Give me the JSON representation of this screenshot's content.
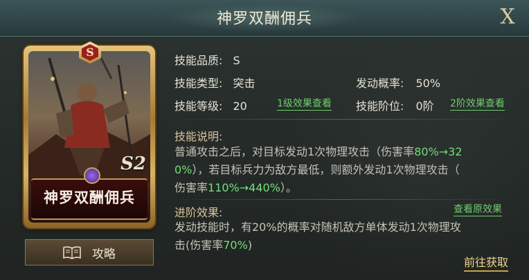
{
  "header": {
    "title": "神罗双酬佣兵",
    "close_label": "X"
  },
  "card": {
    "quality": "S",
    "name": "神罗双酬佣兵",
    "season": "S2"
  },
  "guide_button": {
    "label": "攻略"
  },
  "info": {
    "quality_label": "技能品质:",
    "quality_value": "S",
    "type_label": "技能类型:",
    "type_value": "突击",
    "level_label": "技能等级:",
    "level_value": "20",
    "level_link": "1级效果查看",
    "chance_label": "发动概率:",
    "chance_value": "50%",
    "rank_label": "技能阶位:",
    "rank_value": "0阶",
    "rank_link": "2阶效果查看"
  },
  "description": {
    "title": "技能说明:",
    "line1_a": "普通攻击之后，对目标发动1次物理攻击（伤害率",
    "line1_hl": "80%→32",
    "line2_hl": "0%",
    "line2_b": "），若目标兵力为敌方最低，则额外发动1次物理攻击（",
    "line3_a": "伤害率",
    "line3_hl": "110%→440%",
    "line3_b": "）。"
  },
  "advanced": {
    "title": "进阶效果:",
    "view_original": "查看原效果",
    "line1": "发动技能时，有20%的概率对随机敌方单体发动1次物理攻",
    "line2_a": "击(伤害率",
    "line2_hl": "70%",
    "line2_b": ")"
  },
  "goto_button": {
    "label": "前往获取"
  },
  "colors": {
    "highlight": "#72e07a",
    "link": "#6fcf6f",
    "gold": "#f0d58a"
  }
}
